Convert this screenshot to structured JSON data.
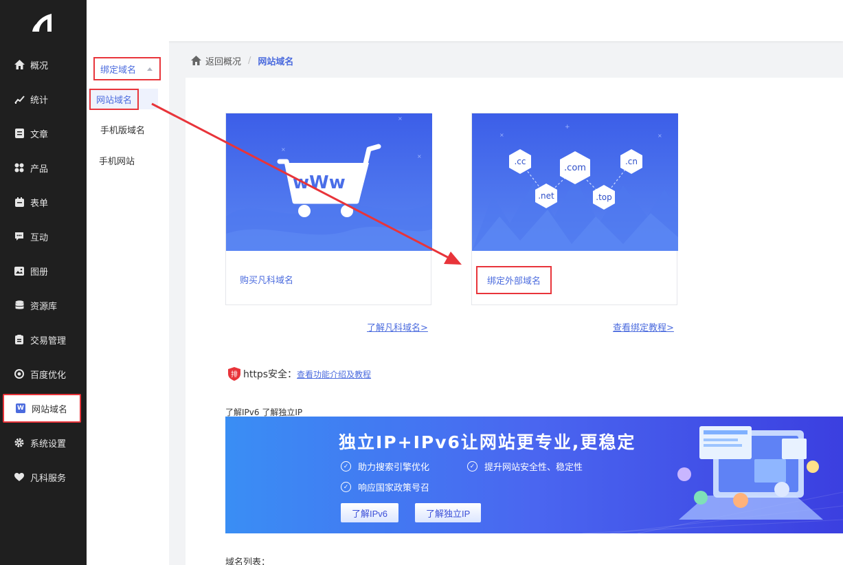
{
  "sidebar": {
    "items": [
      {
        "label": "概况",
        "icon": "home-icon"
      },
      {
        "label": "统计",
        "icon": "chart-icon"
      },
      {
        "label": "文章",
        "icon": "article-icon"
      },
      {
        "label": "产品",
        "icon": "product-icon"
      },
      {
        "label": "表单",
        "icon": "form-icon"
      },
      {
        "label": "互动",
        "icon": "chat-icon"
      },
      {
        "label": "图册",
        "icon": "album-icon"
      },
      {
        "label": "资源库",
        "icon": "database-icon"
      },
      {
        "label": "交易管理",
        "icon": "trade-icon"
      },
      {
        "label": "百度优化",
        "icon": "seo-icon"
      },
      {
        "label": "网站域名",
        "icon": "w-icon",
        "active": true
      },
      {
        "label": "系统设置",
        "icon": "gear-icon"
      },
      {
        "label": "凡科服务",
        "icon": "heart-icon"
      }
    ]
  },
  "subnav": {
    "group_label": "绑定域名",
    "items": [
      "网站域名",
      "手机版域名",
      "手机网站"
    ]
  },
  "breadcrumb": {
    "back": "返回概况",
    "separator": "/",
    "current": "网站域名"
  },
  "cards": {
    "buy": {
      "label": "购买凡科域名",
      "link": "了解凡科域名>",
      "banner_text": "wWw"
    },
    "bind": {
      "label": "绑定外部域名",
      "link": "查看绑定教程>",
      "tlds": [
        ".cc",
        ".com",
        ".cn",
        ".net",
        ".top"
      ]
    }
  },
  "https": {
    "title": "https安全：",
    "link": "查看功能介绍及教程",
    "badge": "排"
  },
  "ipv6": {
    "caption": "了解IPv6 了解独立IP",
    "title": "独立IP+IPv6让网站更专业,更稳定",
    "features": [
      "助力搜索引擎优化",
      "提升网站安全性、稳定性",
      "响应国家政策号召"
    ],
    "btn_ipv6": "了解IPv6",
    "btn_ip": "了解独立IP"
  },
  "domain_list": {
    "title": "域名列表："
  },
  "colors": {
    "accent": "#4b6bde",
    "highlight": "#e8343a",
    "sidebar_bg": "#1f1f1f"
  }
}
